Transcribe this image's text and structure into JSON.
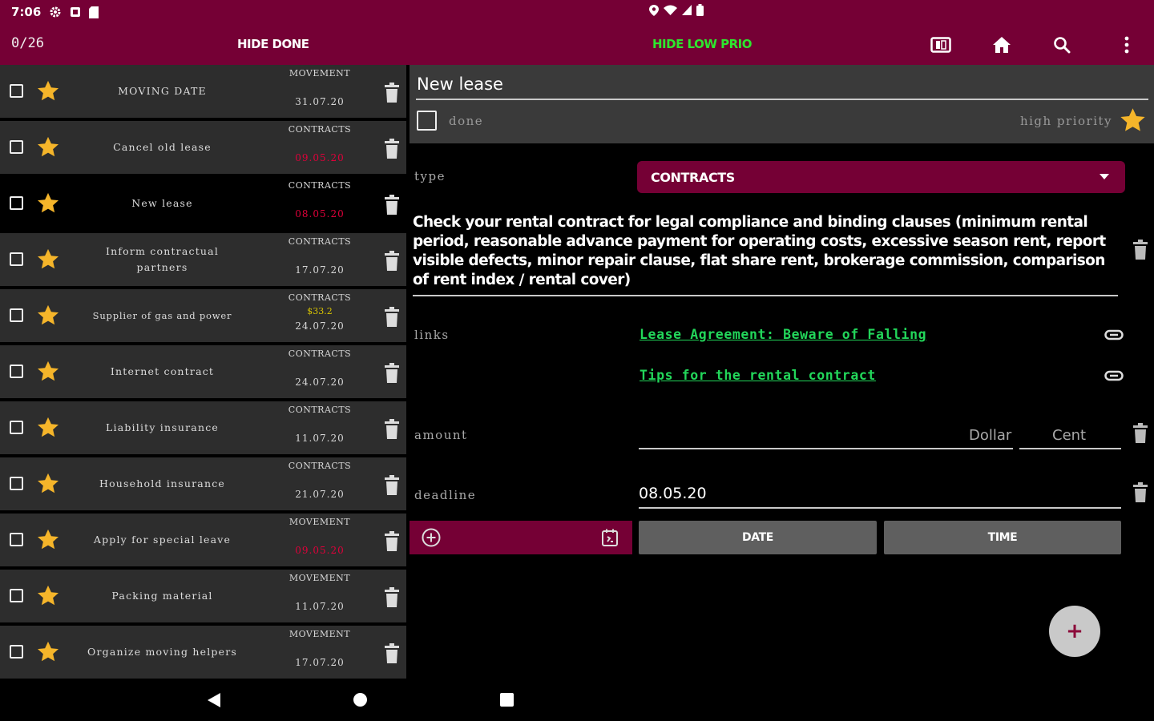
{
  "statusbar": {
    "time": "7:06"
  },
  "appbar": {
    "counter": "0/26",
    "hide_done": "HIDE DONE",
    "hide_low": "HIDE LOW PRIO"
  },
  "tasks": [
    {
      "title": "MOVING DATE",
      "category": "MOVEMENT",
      "amount": "",
      "date": "31.07.20",
      "overdue": false
    },
    {
      "title": "Cancel old lease",
      "category": "CONTRACTS",
      "amount": "",
      "date": "09.05.20",
      "overdue": true
    },
    {
      "title": "New lease",
      "category": "CONTRACTS",
      "amount": "",
      "date": "08.05.20",
      "overdue": true
    },
    {
      "title": "Inform contractual partners",
      "category": "CONTRACTS",
      "amount": "",
      "date": "17.07.20",
      "overdue": false
    },
    {
      "title": "Supplier of gas and power",
      "category": "CONTRACTS",
      "amount": "$33.2",
      "date": "24.07.20",
      "overdue": false
    },
    {
      "title": "Internet contract",
      "category": "CONTRACTS",
      "amount": "",
      "date": "24.07.20",
      "overdue": false
    },
    {
      "title": "Liability insurance",
      "category": "CONTRACTS",
      "amount": "",
      "date": "11.07.20",
      "overdue": false
    },
    {
      "title": "Household insurance",
      "category": "CONTRACTS",
      "amount": "",
      "date": "21.07.20",
      "overdue": false
    },
    {
      "title": "Apply for special leave",
      "category": "MOVEMENT",
      "amount": "",
      "date": "09.05.20",
      "overdue": true
    },
    {
      "title": "Packing material",
      "category": "MOVEMENT",
      "amount": "",
      "date": "11.07.20",
      "overdue": false
    },
    {
      "title": "Organize moving helpers",
      "category": "MOVEMENT",
      "amount": "",
      "date": "17.07.20",
      "overdue": false
    }
  ],
  "detail": {
    "title": "New lease",
    "done_label": "done",
    "high_priority_label": "high priority",
    "type_label": "type",
    "type_value": "CONTRACTS",
    "description": "Check your rental contract for legal compliance and binding clauses (minimum rental period, reasonable advance payment for operating costs, excessive season rent, report visible defects, minor repair clause, flat share rent, brokerage commission, comparison of rent index / rental cover)",
    "links_label": "links",
    "links": [
      "Lease Agreement: Beware of Falling",
      "Tips for the rental contract"
    ],
    "amount_label": "amount",
    "dollar_placeholder": "Dollar",
    "cent_placeholder": "Cent",
    "deadline_label": "deadline",
    "deadline_value": "08.05.20",
    "date_button": "DATE",
    "time_button": "TIME",
    "fab_label": "+"
  },
  "colors": {
    "primary": "#750035",
    "link": "#22d65a",
    "overdue": "#e0003a",
    "star": "#f5b52a",
    "hide_low": "#2ee62e"
  }
}
